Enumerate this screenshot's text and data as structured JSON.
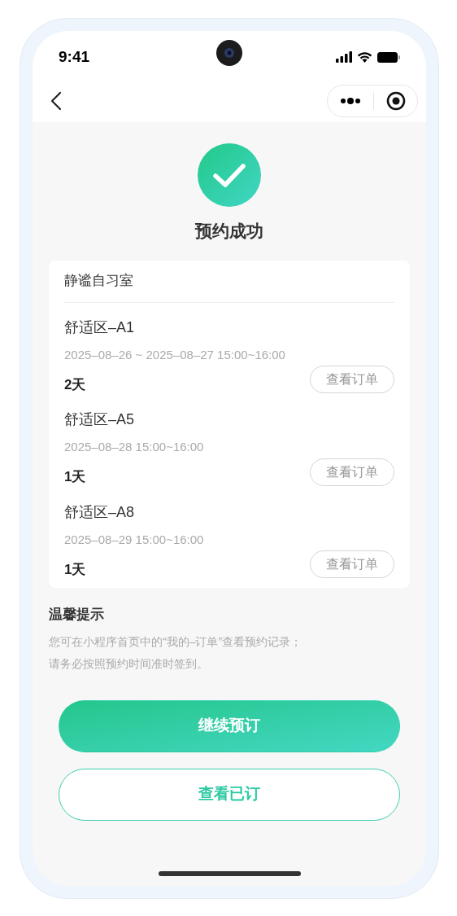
{
  "status_bar": {
    "time": "9:41"
  },
  "result": {
    "title": "预约成功"
  },
  "card": {
    "venue": "静谧自习室",
    "bookings": [
      {
        "seat": "舒适区–A1",
        "time": "2025–08–26 ~ 2025–08–27 15:00~16:00",
        "duration": "2天",
        "button": "查看订单"
      },
      {
        "seat": "舒适区–A5",
        "time": "2025–08–28 15:00~16:00",
        "duration": "1天",
        "button": "查看订单"
      },
      {
        "seat": "舒适区–A8",
        "time": "2025–08–29 15:00~16:00",
        "duration": "1天",
        "button": "查看订单"
      }
    ]
  },
  "tips": {
    "title": "温馨提示",
    "lines": [
      "您可在小程序首页中的“我的–订单”查看预约记录；",
      "请务必按照预约时间准时签到。"
    ]
  },
  "buttons": [
    {
      "label": "继续预订",
      "kind": "primary"
    },
    {
      "label": "查看已订",
      "kind": "outline"
    }
  ]
}
